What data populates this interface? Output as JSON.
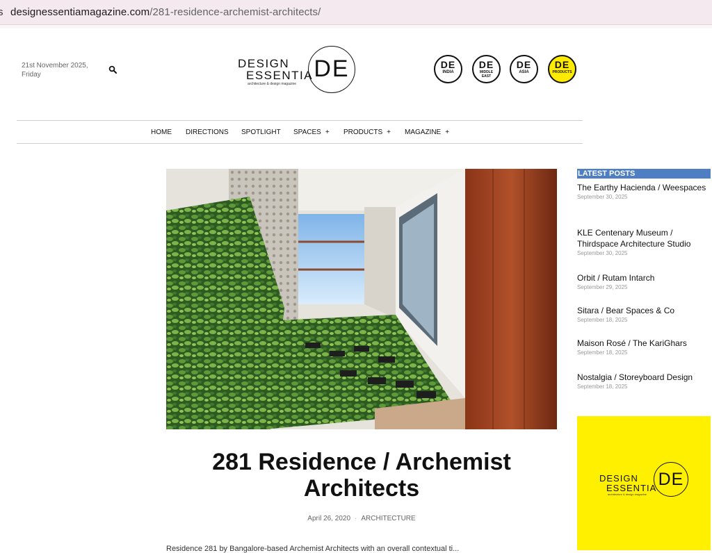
{
  "browser": {
    "lead_glyph": "s",
    "url_domain": "designessentiamagazine.com",
    "url_path": "/281-residence-archemist-architects/"
  },
  "header": {
    "date_line1": "21st November 2025,",
    "date_line2": "Friday",
    "logo": {
      "word1": "DESIGN",
      "word2": "ESSENTIA",
      "tagline": "architecture & design magazine",
      "mark": "DE"
    },
    "editions": [
      {
        "mark": "DE",
        "label": "INDIA"
      },
      {
        "mark": "DE",
        "label": "MIDDLE EAST"
      },
      {
        "mark": "DE",
        "label": "ASIA"
      },
      {
        "mark": "DE",
        "label": "PRODUCTS"
      }
    ]
  },
  "nav": {
    "items": [
      {
        "label": "HOME"
      },
      {
        "label": "DIRECTIONS"
      },
      {
        "label": "SPOTLIGHT"
      },
      {
        "label": "SPACES",
        "expand": "+"
      },
      {
        "label": "PRODUCTS",
        "expand": "+"
      },
      {
        "label": "MAGAZINE",
        "expand": "+"
      }
    ]
  },
  "article": {
    "title": "281 Residence / Archemist Architects",
    "date": "April 26, 2020",
    "category": "ARCHITECTURE",
    "body_peek": "Residence 281 by Bangalore-based Archemist Architects with an overall contextual ti..."
  },
  "sidebar": {
    "heading": "LATEST POSTS",
    "posts": [
      {
        "title": "The Earthy Hacienda / Weespaces",
        "date": "September 30, 2025"
      },
      {
        "title": "KLE Centenary Museum / Thirdspace Architecture Studio",
        "date": "September 30, 2025"
      },
      {
        "title": "Orbit / Rutam Intarch",
        "date": "September 29, 2025"
      },
      {
        "title": "Sitara / Bear Spaces & Co",
        "date": "September 18, 2025"
      },
      {
        "title": "Maison Rosé / The KariGhars",
        "date": "September 18, 2025"
      },
      {
        "title": "Nostalgia / Storeyboard Design",
        "date": "September 18, 2025"
      }
    ],
    "ad": {
      "word1": "DESIGN",
      "word2": "ESSENTIA",
      "tagline": "architecture & design magazine",
      "mark": "DE"
    }
  },
  "colors": {
    "url_bar": "#f4e9ee",
    "latest_heading": "#4f7fc3",
    "ad_yellow": "#fff000",
    "edition_yellow": "#ffeb00"
  }
}
